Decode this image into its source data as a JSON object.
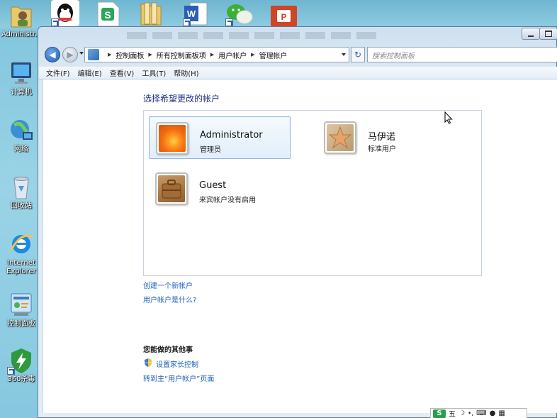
{
  "desktop": {
    "icons": [
      {
        "id": "admin",
        "label": "Administr..."
      },
      {
        "id": "computer",
        "label": "计算机"
      },
      {
        "id": "network",
        "label": "网络"
      },
      {
        "id": "recycle",
        "label": "回收站"
      },
      {
        "id": "ie",
        "label": "Internet Explorer"
      },
      {
        "id": "controlpanel",
        "label": "控制面板"
      },
      {
        "id": "360",
        "label": "360杀毒"
      }
    ],
    "top_icons": [
      "qq-icon",
      "wps-sheet-icon",
      "folder-icon",
      "word-icon",
      "wechat-icon",
      "powerpoint-icon"
    ]
  },
  "window": {
    "breadcrumb": [
      "控制面板",
      "所有控制面板项",
      "用户帐户",
      "管理帐户"
    ],
    "search_placeholder": "搜索控制面板",
    "menu": [
      "文件(F)",
      "编辑(E)",
      "查看(V)",
      "工具(T)",
      "帮助(H)"
    ],
    "heading": "选择希望更改的帐户",
    "accounts": [
      {
        "name": "Administrator",
        "role": "管理员",
        "picture": "flower",
        "selected": true
      },
      {
        "name": "马伊诺",
        "role": "标准用户",
        "picture": "starfish",
        "selected": false
      },
      {
        "name": "Guest",
        "role": "来宾帐户没有启用",
        "picture": "suitcase",
        "selected": false
      }
    ],
    "links": {
      "create": "创建一个新帐户",
      "what_is": "用户帐户是什么?"
    },
    "other_heading": "您能做的其他事",
    "other_links": {
      "parental": "设置家长控制",
      "goto_main": "转到主“用户帐户”页面"
    }
  },
  "ime": {
    "badge": "S",
    "mode": "五"
  }
}
